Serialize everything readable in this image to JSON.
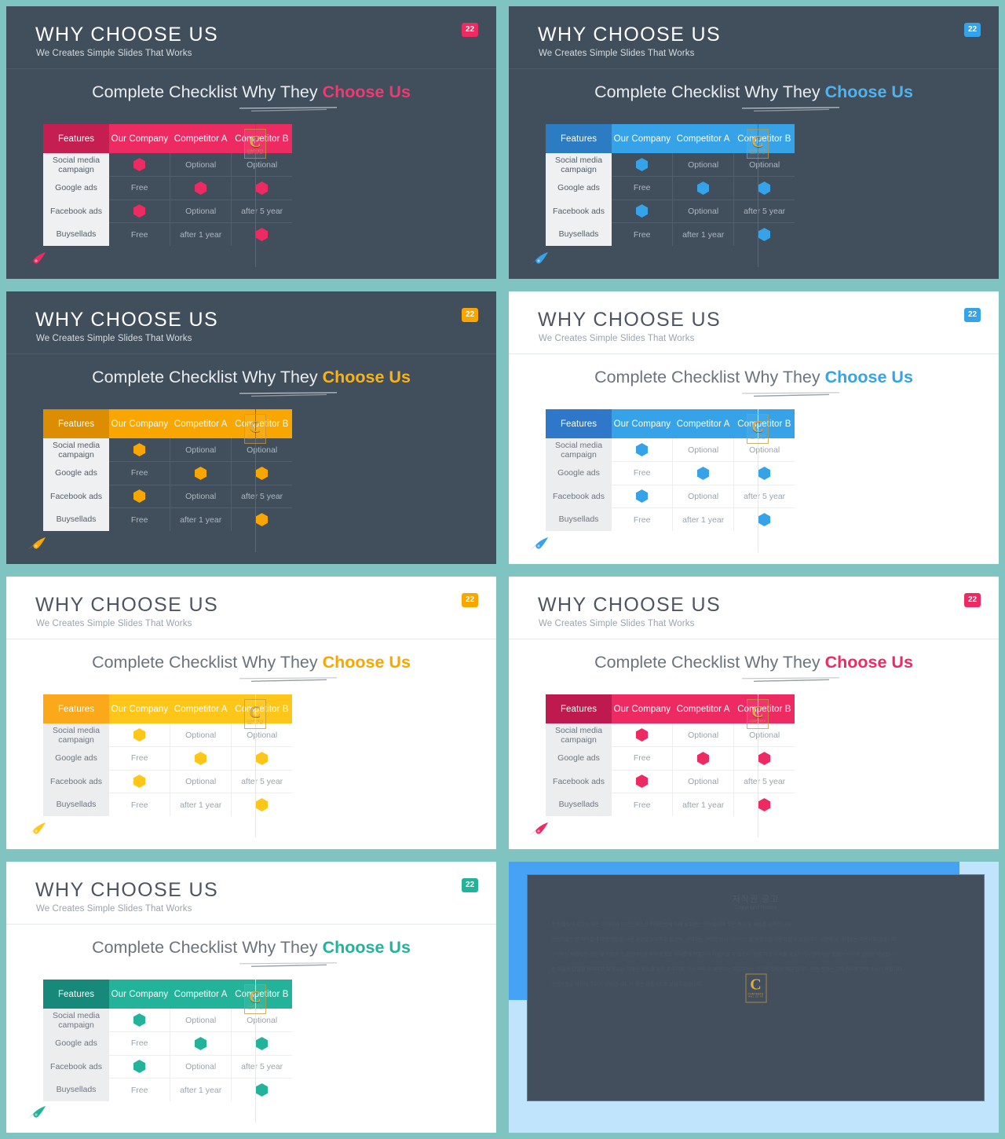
{
  "grid": {
    "separator_color": "#7fc4c0",
    "columns": 2,
    "rows": 4
  },
  "slide_common": {
    "header_title": "WHY CHOOSE US",
    "header_subtitle": "We Creates Simple Slides That Works",
    "page_number": "22",
    "section_title_plain": "Complete Checklist Why They ",
    "section_title_accent": "Choose Us",
    "table": {
      "headers": [
        "Features",
        "Our Company",
        "Competitor A",
        "Competitor B"
      ],
      "rows": [
        {
          "feature": "Social media campaign",
          "our_company": "check",
          "competitor_a": "Optional",
          "competitor_b": "Optional"
        },
        {
          "feature": "Google ads",
          "our_company": "Free",
          "competitor_a": "check",
          "competitor_b": "check"
        },
        {
          "feature": "Facebook ads",
          "our_company": "check",
          "competitor_a": "Optional",
          "competitor_b": "after 5 year"
        },
        {
          "feature": "Buysellads",
          "our_company": "Free",
          "competitor_a": "after 1 year",
          "competitor_b": "check"
        }
      ]
    },
    "watermark": {
      "letter": "C",
      "line1": "CONTENTS",
      "line2": "MALL .CO .KR"
    }
  },
  "slides": [
    {
      "id": "slide-pink-dark",
      "theme": "dark",
      "accent": "#ee2a63",
      "accent_dark": "#c51f52",
      "badge": "#ee2a63",
      "accent_text": "#ee3a70"
    },
    {
      "id": "slide-blue-dark",
      "theme": "dark",
      "accent": "#36a2e8",
      "accent_dark": "#2c7cc4",
      "badge": "#36a2e8",
      "accent_text": "#4fb3ee"
    },
    {
      "id": "slide-orange-dark",
      "theme": "dark",
      "accent": "#f9a600",
      "accent_dark": "#dd8d02",
      "badge": "#f9a600",
      "accent_text": "#f9b318"
    },
    {
      "id": "slide-blue-light",
      "theme": "light",
      "accent": "#36a2e8",
      "accent_dark": "#2f78c9",
      "badge": "#36a2e8",
      "accent_text": "#36a2e8"
    },
    {
      "id": "slide-yellow-light",
      "theme": "light",
      "accent": "#ffc61a",
      "accent_dark": "#fba81a",
      "badge": "#f9a600",
      "accent_text": "#f9a600"
    },
    {
      "id": "slide-pink-light",
      "theme": "light",
      "accent": "#ee2a63",
      "accent_dark": "#bf1a4f",
      "badge": "#ee2a63",
      "accent_text": "#ee2a63"
    },
    {
      "id": "slide-teal-light",
      "theme": "light",
      "accent": "#22b39a",
      "accent_dark": "#16897a",
      "badge": "#22b39a",
      "accent_text": "#22b39a"
    }
  ],
  "copyright_panel": {
    "title": "저작권 공고",
    "subtitle": "Copyright Notice",
    "paragraphs": [
      "본 템플릿에 포함된 모든 이미지와 디자인 요소는 저작권법에 의해 보호받는 저작물이며 무단 복제 및 배포를 금지합니다.",
      "콘텐츠몰은 본 저작물에 대한 정당한 사용 권한을 보유하고 있으며, 구매자는 구매한 범위 내에서만 본 템플릿을 사용하실 수 있습니다. 재판매 및 재배포는 허용되지 않습니다.",
      "구매하신 템플릿은 개인 및 기업의 프레젠테이션 제작 용도로 자유롭게 편집하여 사용하실 수 있으나, 원본 파일 자체를 공유하거나 판매하는 행위는 저작권 침해에 해당합니다.",
      "본 파일에 삽입된 워터마크 및 로고는 저작권 보호를 위한 표식이며, 정식 구매 후 제공되는 파일에서는 제거된 상태로 제공됩니다. 관련 문의는 고객센터로 연락 주시기 바랍니다.",
      "콘텐츠몰을 이용해 주셔서 감사합니다. 더 좋은 템플릿으로 보답하겠습니다."
    ],
    "logo": {
      "letter": "C",
      "line1": "CONTENTS",
      "line2": "MALL .CO .KR"
    },
    "frame_color": "#46a2f5",
    "backdrop_color": "#bfe4fb"
  }
}
